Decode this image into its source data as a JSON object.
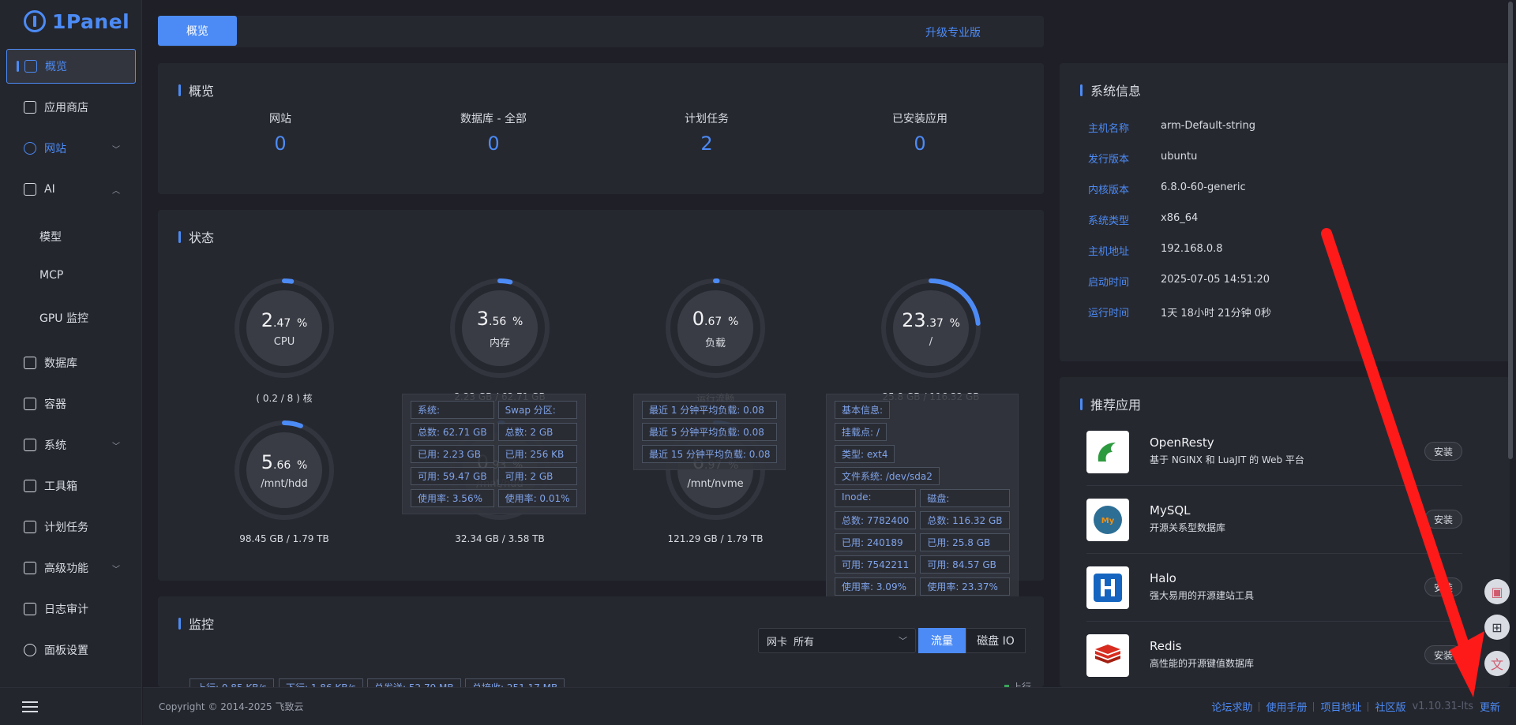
{
  "app": {
    "logo_text": "1Panel"
  },
  "sidebar": {
    "items": [
      {
        "label": "概览",
        "icon": "home-icon"
      },
      {
        "label": "应用商店",
        "icon": "grid-icon"
      },
      {
        "label": "网站",
        "icon": "globe-icon"
      },
      {
        "label": "AI",
        "icon": "robot-icon"
      },
      {
        "label": "数据库",
        "icon": "layers-icon"
      },
      {
        "label": "容器",
        "icon": "docker-icon"
      },
      {
        "label": "系统",
        "icon": "server-icon"
      },
      {
        "label": "工具箱",
        "icon": "toolbox-icon"
      },
      {
        "label": "计划任务",
        "icon": "calendar-icon"
      },
      {
        "label": "高级功能",
        "icon": "diamond-icon"
      },
      {
        "label": "日志审计",
        "icon": "log-icon"
      },
      {
        "label": "面板设置",
        "icon": "gear-icon"
      }
    ],
    "ai_sub": [
      "模型",
      "MCP",
      "GPU 监控"
    ]
  },
  "topbar": {
    "tab_label": "概览",
    "upgrade_label": "升级专业版"
  },
  "overview": {
    "title": "概览",
    "stats": [
      {
        "label": "网站",
        "value": "0"
      },
      {
        "label": "数据库 - 全部",
        "value": "0"
      },
      {
        "label": "计划任务",
        "value": "2"
      },
      {
        "label": "已安装应用",
        "value": "0"
      }
    ]
  },
  "status": {
    "title": "状态",
    "gauges": [
      {
        "int": "2",
        "dec": ".47",
        "unit": "%",
        "name": "CPU",
        "sub": "( 0.2 / 8 ) 核",
        "percent": 2.47
      },
      {
        "int": "3",
        "dec": ".56",
        "unit": "%",
        "name": "内存",
        "sub": "2.23 GB / 62.71 GB",
        "percent": 3.56
      },
      {
        "int": "0",
        "dec": ".67",
        "unit": "%",
        "name": "负载",
        "sub": "运行流畅",
        "percent": 0.67
      },
      {
        "int": "23",
        "dec": ".37",
        "unit": "%",
        "name": "/",
        "sub": "25.8 GB / 116.32 GB",
        "percent": 23.37
      },
      {
        "int": "5",
        "dec": ".66",
        "unit": "%",
        "name": "/mnt/hdd",
        "sub": "98.45 GB / 1.79 TB",
        "percent": 5.66
      },
      {
        "int": "0",
        "dec": ".93",
        "unit": "%",
        "name": "/mnt/hdd",
        "sub": "32.34 GB / 3.58 TB",
        "percent": 0.93
      },
      {
        "int": "6",
        "dec": ".97",
        "unit": "%",
        "name": "/mnt/nvme",
        "sub": "121.29 GB / 1.79 TB",
        "percent": 6.97
      }
    ],
    "mem_tooltip": [
      "系统:",
      "Swap 分区:",
      "总数: 62.71 GB",
      "总数: 2 GB",
      "已用: 2.23 GB",
      "已用: 256 KB",
      "可用: 59.47 GB",
      "可用: 2 GB",
      "使用率: 3.56%",
      "使用率: 0.01%"
    ],
    "load_tooltip": [
      "最近 1 分钟平均负载: 0.08",
      "最近 5 分钟平均负载: 0.08",
      "最近 15 分钟平均负载: 0.08"
    ],
    "disk_tooltip": {
      "base": [
        "基本信息:",
        "挂载点: /",
        "类型: ext4",
        "文件系统: /dev/sda2"
      ],
      "grid": [
        "Inode:",
        "磁盘:",
        "总数: 7782400",
        "总数: 116.32 GB",
        "已用: 240189",
        "已用: 25.8 GB",
        "可用: 7542211",
        "可用: 84.57 GB",
        "使用率: 3.09%",
        "使用率: 23.37%"
      ]
    }
  },
  "monitor": {
    "title": "监控",
    "nic_label": "网卡",
    "nic_value": "所有",
    "tab_traffic": "流量",
    "tab_disk": "磁盘 IO",
    "tags": [
      "上行: 0.85 KB/s",
      "下行: 1.86 KB/s",
      "总发送: 52.79 MB",
      "总接收: 251.17 MB"
    ],
    "legend_up": "上行"
  },
  "sysinfo": {
    "title": "系统信息",
    "rows": [
      {
        "key": "主机名称",
        "value": "arm-Default-string"
      },
      {
        "key": "发行版本",
        "value": "ubuntu"
      },
      {
        "key": "内核版本",
        "value": "6.8.0-60-generic"
      },
      {
        "key": "系统类型",
        "value": "x86_64"
      },
      {
        "key": "主机地址",
        "value": "192.168.0.8"
      },
      {
        "key": "启动时间",
        "value": "2025-07-05 14:51:20"
      },
      {
        "key": "运行时间",
        "value": "1天 18小时 21分钟 0秒"
      }
    ]
  },
  "apps": {
    "title": "推荐应用",
    "install_label": "安装",
    "items": [
      {
        "name": "OpenResty",
        "desc": "基于 NGINX 和 LuaJIT 的 Web 平台",
        "logo_color": "#2e9a3f"
      },
      {
        "name": "MySQL",
        "desc": "开源关系型数据库",
        "logo_color": "#2d6e95"
      },
      {
        "name": "Halo",
        "desc": "强大易用的开源建站工具",
        "logo_color": "#1565c0"
      },
      {
        "name": "Redis",
        "desc": "高性能的开源键值数据库",
        "logo_color": "#d82c20"
      }
    ]
  },
  "footer": {
    "copyright": "Copyright © 2014-2025 飞致云",
    "links": [
      "论坛求助",
      "使用手册",
      "项目地址",
      "社区版"
    ],
    "version": "v1.10.31-lts",
    "update_label": "更新"
  },
  "colors": {
    "accent": "#4c8bf5",
    "bg": "#1f2027",
    "panel": "#262830",
    "annotation_arrow": "#ff1a1a"
  }
}
